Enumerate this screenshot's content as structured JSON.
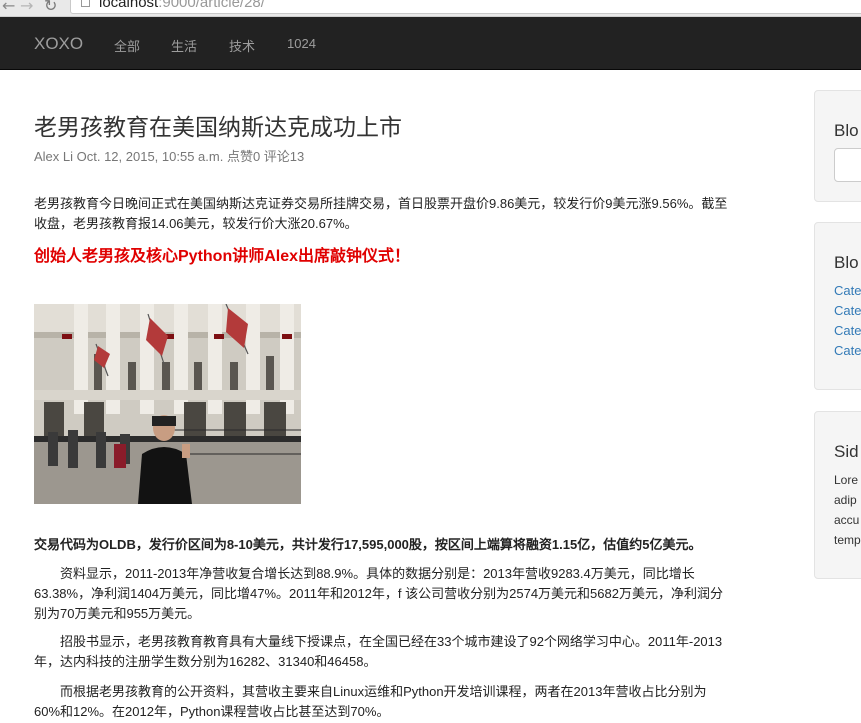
{
  "browser": {
    "url_host": "localhost",
    "url_rest": ":9000/article/28/",
    "back_icon": "back-arrow-icon",
    "forward_icon": "forward-arrow-icon",
    "reload_icon": "reload-icon"
  },
  "navbar": {
    "brand": "XOXO",
    "items": [
      "全部",
      "生活",
      "技术",
      "1024"
    ]
  },
  "article": {
    "title": "老男孩教育在美国纳斯达克成功上市",
    "meta": "Alex Li Oct. 12, 2015, 10:55 a.m. 点赞0 评论13",
    "p1_line1": "老男孩教育今日晚间正式在美国纳斯达克证券交易所挂牌交易，首日股票开盘价9.86美元，较发行价9美元涨9.56%。截至",
    "p1_line2": "收盘，老男孩教育报14.06美元，较发行价大涨20.67%。",
    "red_heading": "创始人老男孩及核心Python讲师Alex出席敲钟仪式！",
    "bold_line": "交易代码为OLDB，发行价区间为8-10美元，共计发行17,595,000股，按区间上端算将融资1.15亿，估值约5亿美元。",
    "p2_line1": "资料显示，2011-2013年净营收复合增长达到88.9%。具体的数据分别是：2013年营收9283.4万美元，同比增长",
    "p2_line2": "63.38%，净利润1404万美元，同比增47%。2011年和2012年，f 该公司营收分别为2574万美元和5682万美元，净利润分",
    "p2_line3": "别为70万美元和955万美元。",
    "p3_line1": "招股书显示，老男孩教育教育具有大量线下授课点，在全国已经在33个城市建设了92个网络学习中心。2011年-2013",
    "p3_line2": "年，达内科技的注册学生数分别为16282、31340和46458。",
    "p4_line1": "而根据老男孩教育的公开资料，其营收主要来自Linux运维和Python开发培训课程，两者在2013年营收占比分别为",
    "p4_line2": "60%和12%。在2012年，Python课程营收占比甚至达到70%。"
  },
  "sidebar": {
    "search_title": "Blo",
    "categories_title": "Blo",
    "categories": [
      "Cate",
      "Cate",
      "Cate",
      "Cate"
    ],
    "widget_title": "Sid",
    "widget_lines": [
      "Lore",
      "adip",
      "accu",
      "temp"
    ]
  }
}
